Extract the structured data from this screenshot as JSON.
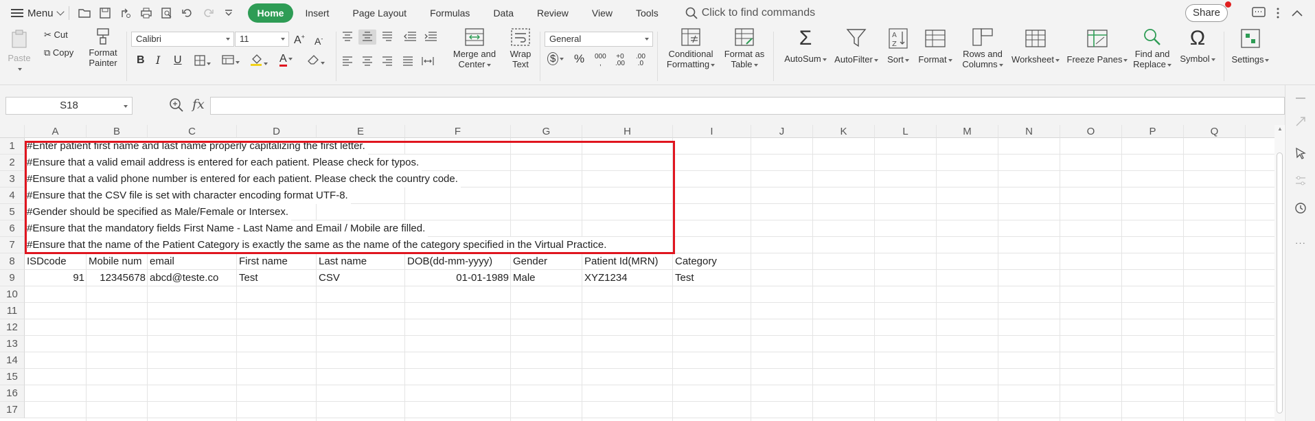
{
  "menubar": {
    "menu_label": "Menu",
    "tabs": [
      "Home",
      "Insert",
      "Page Layout",
      "Formulas",
      "Data",
      "Review",
      "View",
      "Tools"
    ],
    "search_placeholder": "Click to find commands",
    "share_label": "Share"
  },
  "ribbon": {
    "paste": "Paste",
    "cut": "Cut",
    "copy": "Copy",
    "format_painter_1": "Format",
    "format_painter_2": "Painter",
    "font_name": "Calibri",
    "font_size": "11",
    "merge_1": "Merge and",
    "merge_2": "Center",
    "wrap_1": "Wrap",
    "wrap_2": "Text",
    "number_format": "General",
    "cond_1": "Conditional",
    "cond_2": "Formatting",
    "fmt_table_1": "Format as",
    "fmt_table_2": "Table",
    "autosum": "AutoSum",
    "autofilter": "AutoFilter",
    "sort": "Sort",
    "format": "Format",
    "rows_cols_1": "Rows and",
    "rows_cols_2": "Columns",
    "worksheet": "Worksheet",
    "freeze": "Freeze Panes",
    "find_1": "Find and",
    "find_2": "Replace",
    "symbol": "Symbol",
    "settings": "Settings"
  },
  "formula_bar": {
    "name_box": "S18",
    "fx_label": "fx",
    "formula": ""
  },
  "sheet": {
    "columns": [
      "A",
      "B",
      "C",
      "D",
      "E",
      "F",
      "G",
      "H",
      "I",
      "J",
      "K",
      "L",
      "M",
      "N",
      "O",
      "P",
      "Q"
    ],
    "rows": [
      "1",
      "2",
      "3",
      "4",
      "5",
      "6",
      "7",
      "8",
      "9",
      "10",
      "11",
      "12",
      "13",
      "14",
      "15",
      "16",
      "17"
    ],
    "notes": [
      "#Enter patient first name and last name properly capitalizing the first letter.",
      "#Ensure that a valid email address is entered for each patient. Please check for typos.",
      "#Ensure that a valid phone number is entered for each patient. Please check the country code.",
      "#Ensure that the CSV file is set with character encoding format UTF-8.",
      "#Gender should be specified as Male/Female or Intersex.",
      "#Ensure that the mandatory fields First Name - Last Name and Email / Mobile are filled.",
      "#Ensure that the name of the Patient Category is exactly the same as the name of the category specified in the Virtual Practice."
    ],
    "headers": [
      "ISDcode",
      "Mobile num",
      "email",
      "First name",
      "Last name",
      "DOB(dd-mm-yyyy)",
      "Gender",
      "Patient Id(MRN)",
      "Category"
    ],
    "row9": [
      "91",
      "12345678",
      "abcd@teste.co",
      "Test",
      "CSV",
      "01-01-1989",
      "Male",
      "XYZ1234",
      "Test"
    ]
  },
  "colors": {
    "accent": "#2e9c55",
    "highlight_border": "#e0151f"
  }
}
